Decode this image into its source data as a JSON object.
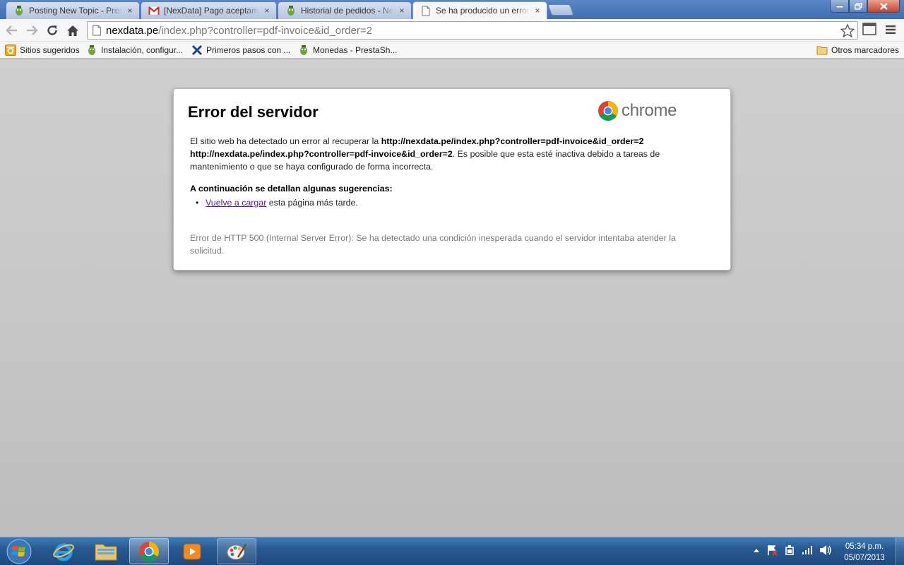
{
  "browser": {
    "tabs": [
      {
        "title": "Posting New Topic - Prest",
        "icon": "prestashop-icon",
        "active": false
      },
      {
        "title": "[NexData] Pago aceptamo",
        "icon": "gmail-icon",
        "active": false
      },
      {
        "title": "Historial de pedidos - Nex",
        "icon": "prestashop-icon",
        "active": false
      },
      {
        "title": "Se ha producido un error al",
        "icon": "page-icon",
        "active": true
      }
    ],
    "tab_close_glyph": "×",
    "url_host": "nexdata.pe",
    "url_path": "/index.php?controller=pdf-invoice&id_order=2",
    "bookmarks": [
      {
        "label": "Sitios sugeridos",
        "icon": "suggested-sites-icon"
      },
      {
        "label": "Instalación, configur...",
        "icon": "prestashop-icon"
      },
      {
        "label": "Primeros pasos con ...",
        "icon": "x-logo-icon"
      },
      {
        "label": "Monedas - PrestaSh...",
        "icon": "prestashop-icon"
      }
    ],
    "other_bookmarks": "Otros marcadores"
  },
  "error_page": {
    "title": "Error del servidor",
    "brand": "chrome",
    "main_prefix": "El sitio web ha detectado un error al recuperar la ",
    "url_bold_1": "http://nexdata.pe/index.php?controller=pdf-invoice&id_order=2",
    "url_bold_2": "http://nexdata.pe/index.php?controller=pdf-invoice&id_order=2",
    "main_suffix": ". Es posible que esta esté inactiva debido a tareas de mantenimiento o que se haya configurado de forma incorrecta.",
    "suggestions_heading": "A continuación se detallan algunas sugerencias:",
    "reload_link": "Vuelve a cargar",
    "reload_rest": " esta página más tarde.",
    "detail": "Error de HTTP 500 (Internal Server Error): Se ha detectado una condición inesperada cuando el servidor intentaba atender la solicitud."
  },
  "taskbar": {
    "time": "05:34 p.m.",
    "date": "05/07/2013"
  },
  "colors": {
    "link_visited": "#551a8b",
    "taskbar": "#275a92",
    "close_button": "#c7422b"
  }
}
